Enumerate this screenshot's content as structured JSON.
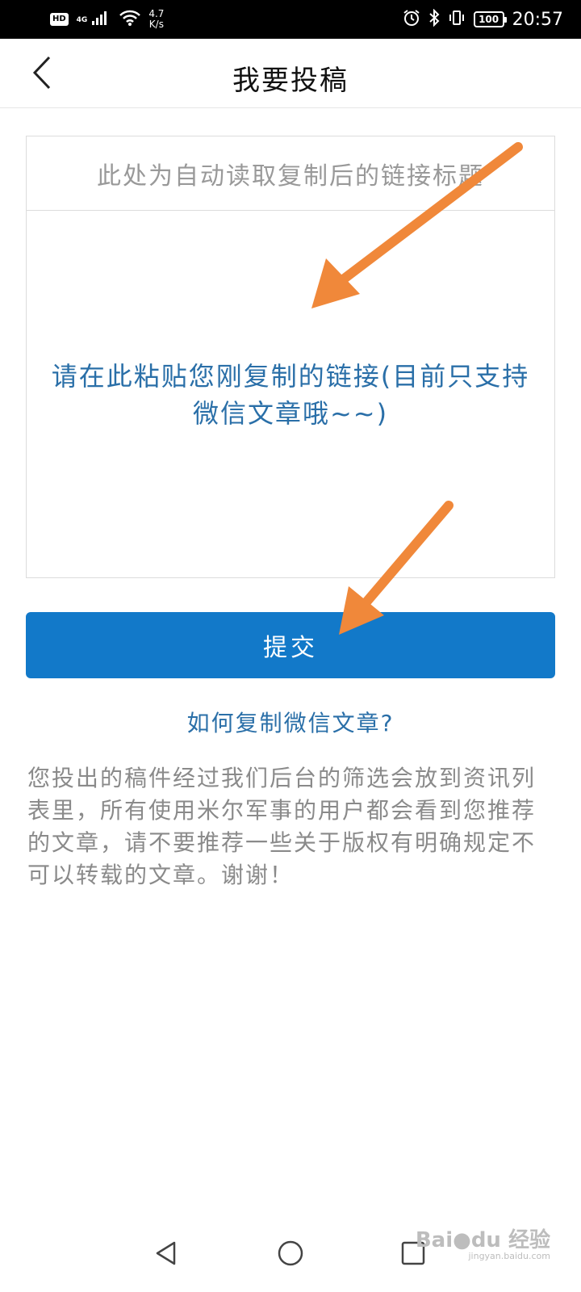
{
  "status_bar": {
    "hd": "HD",
    "network": "4G",
    "speed_value": "4.7",
    "speed_unit": "K/s",
    "battery": "100",
    "time": "20:57"
  },
  "header": {
    "title": "我要投稿"
  },
  "form": {
    "title_placeholder": "此处为自动读取复制后的链接标题",
    "link_placeholder": "请在此粘贴您刚复制的链接(目前只支持微信文章哦~~)"
  },
  "submit_label": "提交",
  "how_to_link": "如何复制微信文章?",
  "notice": "您投出的稿件经过我们后台的筛选会放到资讯列表里，所有使用米尔军事的用户都会看到您推荐的文章，请不要推荐一些关于版权有明确规定不可以转载的文章。谢谢！",
  "watermark": {
    "brand": "Bai●du 经验",
    "url": "jingyan.baidu.com"
  },
  "colors": {
    "accent": "#1279c9",
    "link": "#2a6fa8",
    "arrow": "#f0883a"
  }
}
